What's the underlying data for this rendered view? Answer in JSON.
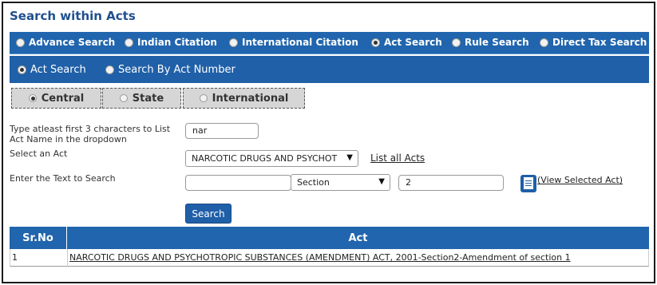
{
  "page_title": "Search within Acts",
  "search_types": [
    {
      "label": "Advance Search",
      "selected": false
    },
    {
      "label": "Indian Citation",
      "selected": false
    },
    {
      "label": "International Citation",
      "selected": false
    },
    {
      "label": "Act Search",
      "selected": true
    },
    {
      "label": "Rule Search",
      "selected": false
    },
    {
      "label": "Direct Tax Search",
      "selected": false
    }
  ],
  "act_modes": [
    {
      "label": "Act Search",
      "selected": true
    },
    {
      "label": "Search By Act Number",
      "selected": false
    }
  ],
  "jurisdictions": [
    {
      "label": "Central",
      "selected": true
    },
    {
      "label": "State",
      "selected": false
    },
    {
      "label": "International",
      "selected": false
    }
  ],
  "form": {
    "act_name_label": "Type atleast first 3 characters to List Act Name in the dropdown",
    "act_name_value": "nar",
    "select_act_label": "Select an Act",
    "select_act_value": "NARCOTIC DRUGS AND PSYCHOT",
    "list_all_acts": "List all Acts",
    "search_text_label": "Enter the Text to Search",
    "search_text_value": "",
    "section_select_value": "Section",
    "section_number_value": "2",
    "view_selected_act": "(View Selected Act)",
    "search_button": "Search"
  },
  "results": {
    "headers": [
      "Sr.No",
      "Act"
    ],
    "rows": [
      {
        "sr": "1",
        "act": "NARCOTIC DRUGS AND PSYCHOTROPIC SUBSTANCES (AMENDMENT) ACT, 2001-Section2-Amendment of section 1"
      }
    ]
  },
  "colors": {
    "header_bar": "#2065ad",
    "title": "#1f4f8f",
    "tab_bg": "#d6d6d6"
  },
  "icons": {
    "view_act": "document-icon"
  }
}
